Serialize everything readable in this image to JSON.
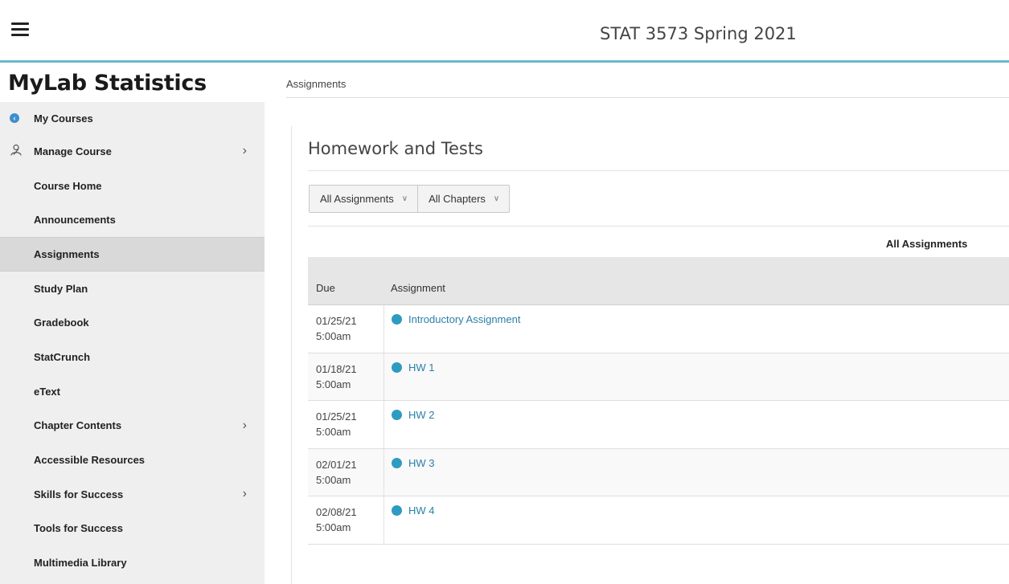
{
  "header": {
    "course_title": "STAT 3573 Spring 2021"
  },
  "sidebar": {
    "brand": "MyLab Statistics",
    "items": [
      {
        "label": "My Courses",
        "icon": "back-circle-icon"
      },
      {
        "label": "Manage Course",
        "icon": "manage-user-icon",
        "chevron": true
      },
      {
        "label": "Course Home"
      },
      {
        "label": "Announcements"
      },
      {
        "label": "Assignments",
        "active": true
      },
      {
        "label": "Study Plan"
      },
      {
        "label": "Gradebook"
      },
      {
        "label": "StatCrunch"
      },
      {
        "label": "eText"
      },
      {
        "label": "Chapter Contents",
        "chevron": true
      },
      {
        "label": "Accessible Resources"
      },
      {
        "label": "Skills for Success",
        "chevron": true
      },
      {
        "label": "Tools for Success"
      },
      {
        "label": "Multimedia Library"
      }
    ]
  },
  "main": {
    "breadcrumb": "Assignments",
    "title": "Homework and Tests",
    "filters": [
      {
        "label": "All Assignments"
      },
      {
        "label": "All Chapters"
      }
    ],
    "filter_summary": "All Assignments",
    "table": {
      "columns": [
        "Due",
        "Assignment"
      ],
      "rows": [
        {
          "date": "01/25/21",
          "time": "5:00am",
          "name": "Introductory Assignment"
        },
        {
          "date": "01/18/21",
          "time": "5:00am",
          "name": "HW 1"
        },
        {
          "date": "01/25/21",
          "time": "5:00am",
          "name": "HW 2"
        },
        {
          "date": "02/01/21",
          "time": "5:00am",
          "name": "HW 3"
        },
        {
          "date": "02/08/21",
          "time": "5:00am",
          "name": "HW 4"
        }
      ]
    }
  },
  "colors": {
    "accent": "#6ab8cc",
    "link": "#2a7fa8",
    "status_dot": "#2e9bc0"
  }
}
